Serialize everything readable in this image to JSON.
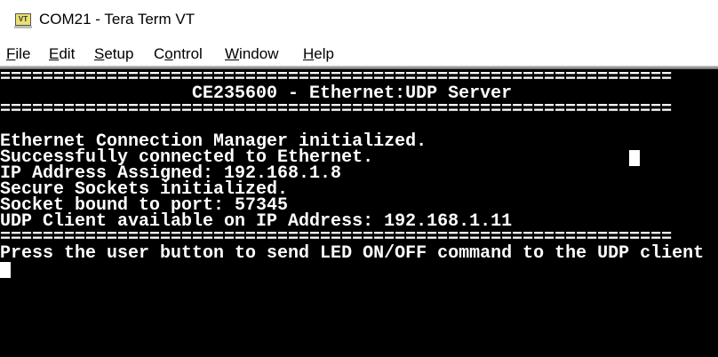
{
  "window": {
    "title": "COM21 - Tera Term VT",
    "icon": "VT"
  },
  "menu": [
    {
      "label": "File",
      "accel": "F",
      "rest": "ile"
    },
    {
      "label": "Edit",
      "accel": "E",
      "rest": "dit"
    },
    {
      "label": "Setup",
      "accel": "S",
      "rest": "etup"
    },
    {
      "label": "Control",
      "pre": "C",
      "accel": "o",
      "rest": "ntrol"
    },
    {
      "label": "Window",
      "accel": "W",
      "rest": "indow"
    },
    {
      "label": "Help",
      "accel": "H",
      "rest": "elp"
    }
  ],
  "terminal": {
    "lines": [
      "===============================================================",
      "                  CE235600 - Ethernet:UDP Server",
      "===============================================================",
      "",
      "Ethernet Connection Manager initialized.",
      "Successfully connected to Ethernet.",
      "IP Address Assigned: 192.168.1.8",
      "Secure Sockets initialized.",
      "Socket bound to port: 57345",
      "UDP Client available on IP Address: 192.168.1.11",
      "===============================================================",
      "Press the user button to send LED ON/OFF command to the UDP client"
    ]
  }
}
